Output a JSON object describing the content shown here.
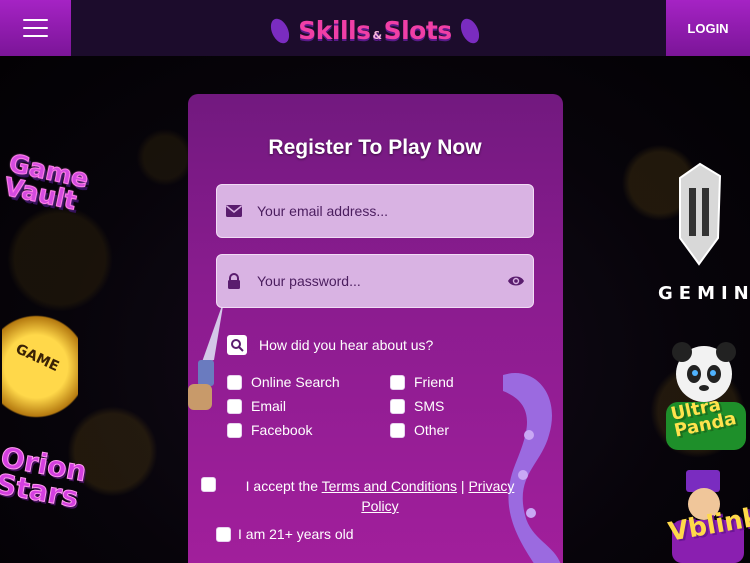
{
  "header": {
    "logo_left": "Skills",
    "logo_amp": "&",
    "logo_right": "Slots",
    "login_label": "LOGIN"
  },
  "form": {
    "title": "Register To Play Now",
    "email_placeholder": "Your email address...",
    "password_placeholder": "Your password...",
    "hear_label": "How did you hear about us?",
    "options": [
      "Online Search",
      "Email",
      "Facebook",
      "Friend",
      "SMS",
      "Other"
    ],
    "terms_prefix": "I accept the ",
    "terms_link": "Terms and Conditions",
    "terms_sep": " | ",
    "privacy_link": "Privacy Policy",
    "age_label": "I am 21+ years old"
  },
  "side_games": {
    "left": [
      "Game Vault",
      "GAME",
      "Orion Stars"
    ],
    "right": [
      "GEMINI",
      "Ultra Panda",
      "Vblink"
    ]
  },
  "colors": {
    "accent": "#a523c4",
    "logo_pink": "#f03fa6",
    "card_top": "#72197f",
    "field_bg": "#d9b3e3"
  }
}
